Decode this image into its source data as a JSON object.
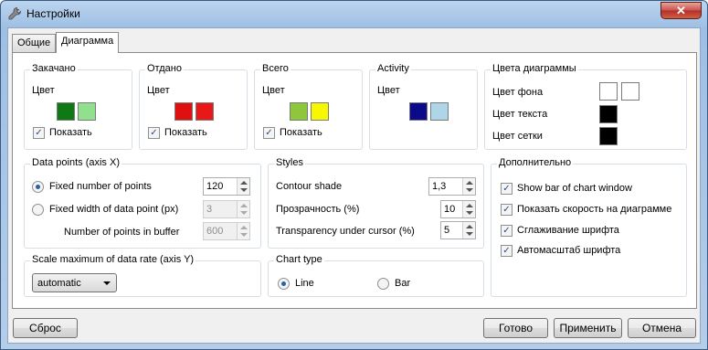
{
  "window": {
    "title": "Настройки",
    "close_label": "✕"
  },
  "tabs": [
    {
      "label": "Общие"
    },
    {
      "label": "Диаграмма"
    }
  ],
  "colors_groups": [
    {
      "title": "Закачано",
      "color_label": "Цвет",
      "show_label": "Показать",
      "show_checked": true,
      "colors": [
        "#0f7a14",
        "#90e08e"
      ]
    },
    {
      "title": "Отдано",
      "color_label": "Цвет",
      "show_label": "Показать",
      "show_checked": true,
      "colors": [
        "#e01010",
        "#e81818"
      ]
    },
    {
      "title": "Всего",
      "color_label": "Цвет",
      "show_label": "Показать",
      "show_checked": true,
      "colors": [
        "#8ec63c",
        "#f7f700"
      ]
    },
    {
      "title": "Activity",
      "color_label": "Цвет",
      "colors": [
        "#0a0a8a",
        "#aed6e8"
      ]
    }
  ],
  "chart_colors": {
    "title": "Цвета диаграммы",
    "background_label": "Цвет фона",
    "background_colors": [
      "#ffffff",
      "#ffffff"
    ],
    "text_label": "Цвет текста",
    "text_color": "#000000",
    "grid_label": "Цвет сетки",
    "grid_color": "#000000"
  },
  "data_points": {
    "title": "Data points (axis X)",
    "fixed_number_label": "Fixed number of points",
    "fixed_number_value": "120",
    "fixed_number_selected": true,
    "fixed_width_label": "Fixed width of data point (px)",
    "fixed_width_value": "3",
    "buffer_label": "Number of points in buffer",
    "buffer_value": "600"
  },
  "styles": {
    "title": "Styles",
    "contour_label": "Contour shade",
    "contour_value": "1,3",
    "transparency_label": "Прозрачность (%)",
    "transparency_value": "10",
    "cursor_transparency_label": "Transparency under cursor (%)",
    "cursor_transparency_value": "5"
  },
  "additional": {
    "title": "Дополнительно",
    "options": [
      {
        "label": "Show bar of chart window",
        "checked": true
      },
      {
        "label": "Показать скорость на диаграмме",
        "checked": true
      },
      {
        "label": "Сглаживание шрифта",
        "checked": true
      },
      {
        "label": "Автомасштаб шрифта",
        "checked": true
      }
    ]
  },
  "scale": {
    "title": "Scale maximum of data rate (axis Y)",
    "selected": "automatic"
  },
  "chart_type": {
    "title": "Chart type",
    "line_label": "Line",
    "bar_label": "Bar",
    "selected": "Line"
  },
  "buttons": {
    "reset": "Сброс",
    "ok": "Готово",
    "apply": "Применить",
    "cancel": "Отмена"
  }
}
